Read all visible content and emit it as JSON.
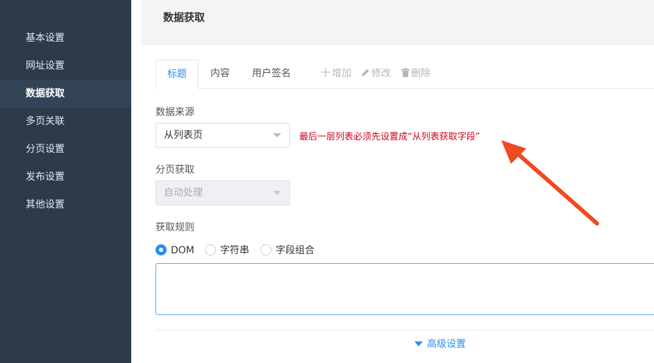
{
  "sidebar": {
    "items": [
      {
        "label": "基本设置"
      },
      {
        "label": "网址设置"
      },
      {
        "label": "数据获取",
        "active": true
      },
      {
        "label": "多页关联"
      },
      {
        "label": "分页设置"
      },
      {
        "label": "发布设置"
      },
      {
        "label": "其他设置"
      }
    ]
  },
  "header": {
    "title": "数据获取"
  },
  "tabs": {
    "items": [
      {
        "label": "标题",
        "active": true
      },
      {
        "label": "内容"
      },
      {
        "label": "用户签名"
      }
    ],
    "actions": [
      {
        "label": "增加",
        "icon": "plus-icon"
      },
      {
        "label": "修改",
        "icon": "pencil-icon"
      },
      {
        "label": "删除",
        "icon": "trash-icon"
      }
    ]
  },
  "form": {
    "data_source": {
      "label": "数据来源",
      "value": "从列表页",
      "warning": "最后一层列表必须先设置成“从列表获取字段”"
    },
    "paging": {
      "label": "分页获取",
      "value": "自动处理",
      "disabled": true
    },
    "rule": {
      "label": "获取规则",
      "options": [
        {
          "label": "DOM",
          "checked": true
        },
        {
          "label": "字符串"
        },
        {
          "label": "字段组合"
        }
      ],
      "value": ""
    }
  },
  "advanced": {
    "label": "高级设置"
  },
  "colors": {
    "sidebar_bg": "#2c3a4a",
    "accent": "#2a8ff0",
    "warning": "#d0021b",
    "arrow": "#f04a23"
  }
}
